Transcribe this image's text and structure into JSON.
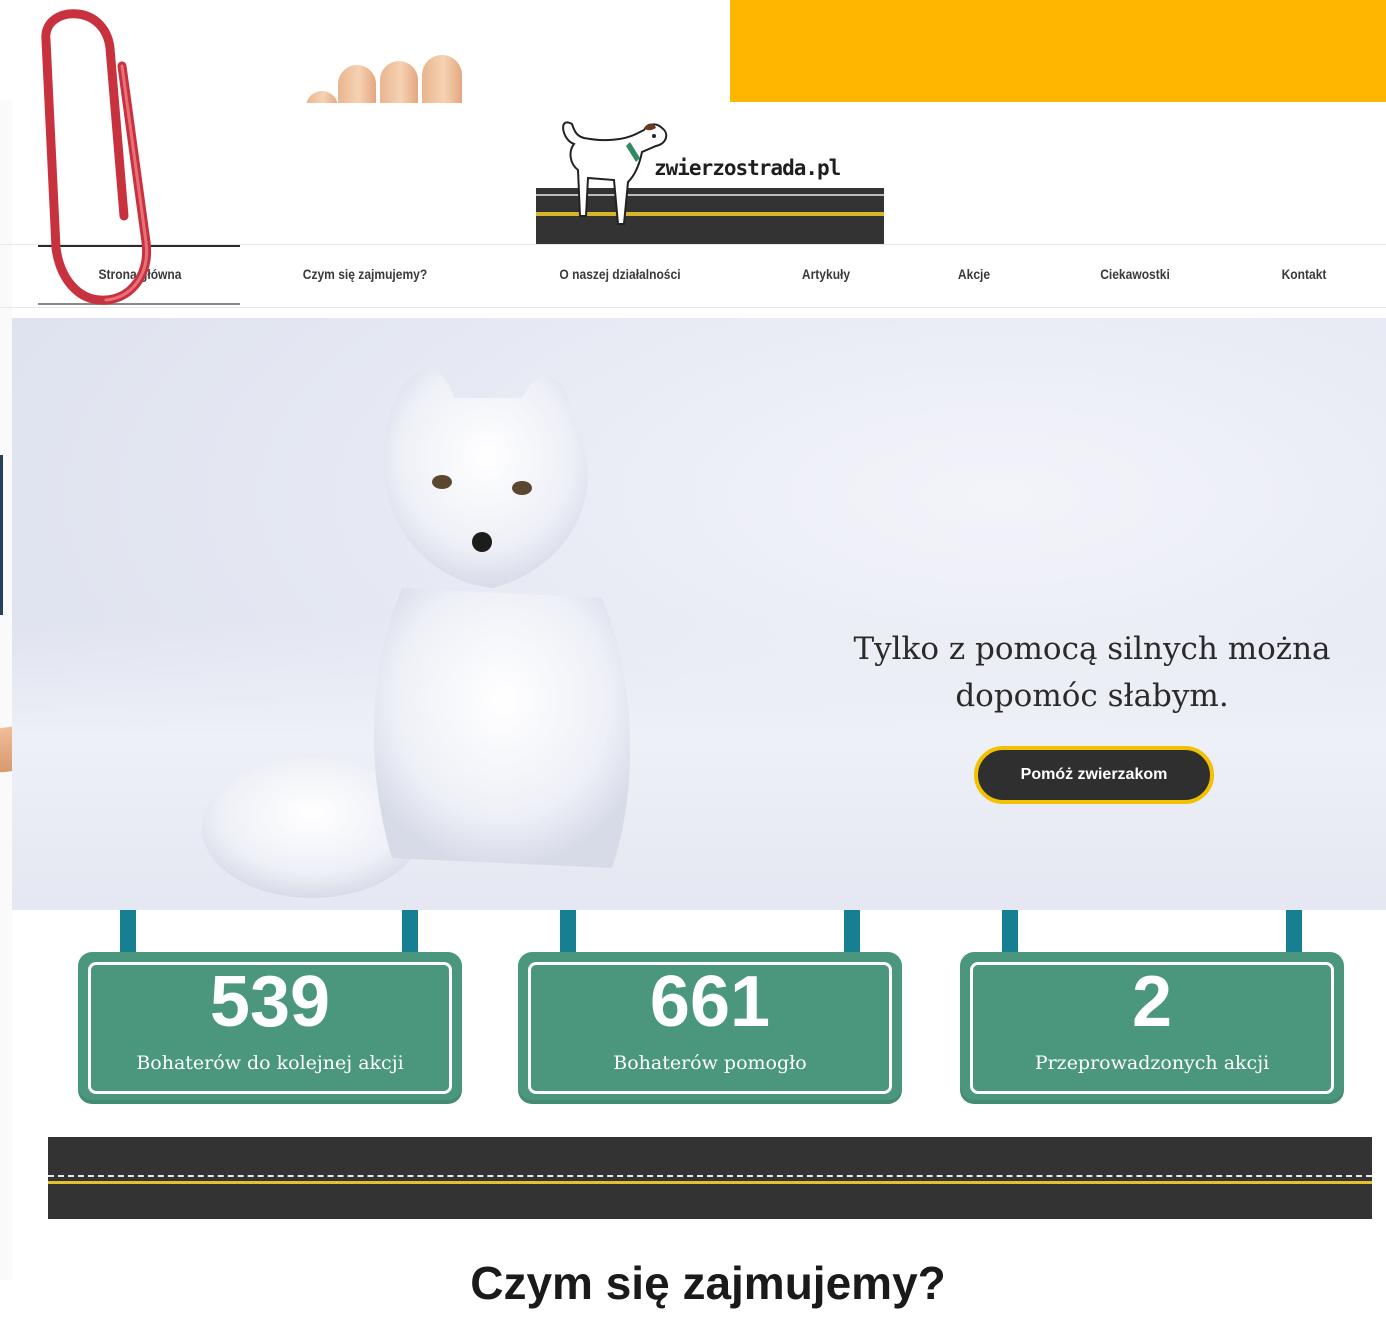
{
  "logo": {
    "text": "zwierzostrada.pl"
  },
  "nav": {
    "items": [
      {
        "label": "Strona główna"
      },
      {
        "label": "Czym się zajmujemy?"
      },
      {
        "label": "O naszej działalności"
      },
      {
        "label": "Artykuły"
      },
      {
        "label": "Akcje"
      },
      {
        "label": "Ciekawostki"
      },
      {
        "label": "Kontakt"
      }
    ]
  },
  "hero": {
    "quote_line1": "Tylko z pomocą silnych można",
    "quote_line2": "dopomóc słabym.",
    "button_label": "Pomóż zwierzakom"
  },
  "stats": [
    {
      "number": "539",
      "label": "Bohaterów do kolejnej akcji"
    },
    {
      "number": "661",
      "label": "Bohaterów pomogło"
    },
    {
      "number": "2",
      "label": "Przeprowadzonych akcji"
    }
  ],
  "section": {
    "title": "Czym się zajmujemy?"
  },
  "colors": {
    "accent_yellow": "#ffb600",
    "sign_green": "#4a977e",
    "post_teal": "#167f92",
    "road_dark": "#333333"
  }
}
